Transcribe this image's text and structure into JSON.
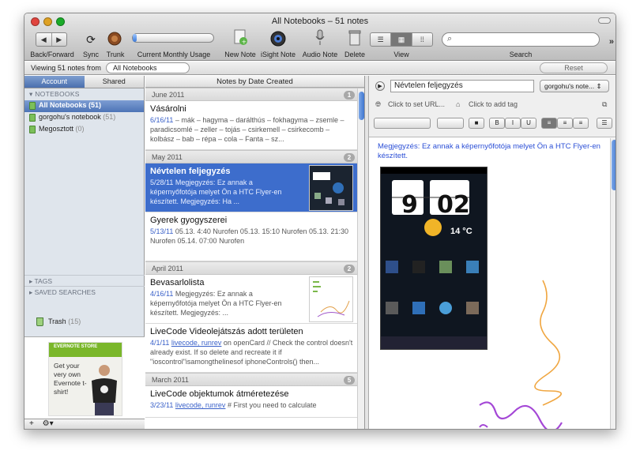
{
  "window": {
    "title": "All Notebooks – 51 notes"
  },
  "toolbar": {
    "back_forward": "Back/Forward",
    "sync": "Sync",
    "trunk": "Trunk",
    "usage": "Current Monthly Usage",
    "usage_fraction": 0.05,
    "new_note": "New Note",
    "isight_note": "iSight Note",
    "audio_note": "Audio Note",
    "delete": "Delete",
    "view": "View",
    "search": "Search"
  },
  "filter": {
    "viewing_label": "Viewing 51 notes from",
    "scope_value": "All Notebooks",
    "reset": "Reset"
  },
  "sidebar": {
    "tabs": [
      "Account",
      "Shared"
    ],
    "notebooks_header": "NOTEBOOKS",
    "notebooks": [
      {
        "name": "All Notebooks",
        "count": "(51)"
      },
      {
        "name": "gorgohu's notebook",
        "count": "(51)"
      },
      {
        "name": "Megosztott",
        "count": "(0)"
      }
    ],
    "tags_header": "TAGS",
    "saved_header": "SAVED SEARCHES",
    "trash": {
      "name": "Trash",
      "count": "(15)"
    },
    "ad": {
      "brand": "EVERNOTE STORE",
      "text": "Get your very own Evernote t-shirt!"
    }
  },
  "notes_list": {
    "header": "Notes by Date Created",
    "groups": [
      {
        "month": "June 2011",
        "count": "1",
        "notes": [
          {
            "title": "Vásárolni",
            "date": "6/16/11",
            "snippet": " – mák – hagyma – darálthús – fokhagyma – zsemle – paradicsomlé – zeller – tojás – csirkemell – csirkecomb – kolbász – bab – répa – cola – Fanta – sz..."
          }
        ]
      },
      {
        "month": "May 2011",
        "count": "2",
        "notes": [
          {
            "title": "Névtelen feljegyzés",
            "date": "5/28/11",
            "snippet": " Megjegyzés: Ez annak a képernyőfotója melyet Ön a HTC Flyer-en készített. Megjegyzés: Ha ..."
          },
          {
            "title": "Gyerek gyogyszerei",
            "date": "5/13/11",
            "snippet": " 05.13. 4:40 Nurofen 05.13. 15:10 Nurofen 05.13. 21:30 Nurofen 05.14. 07:00 Nurofen"
          }
        ]
      },
      {
        "month": "April 2011",
        "count": "2",
        "notes": [
          {
            "title": "Bevasarlolista",
            "date": "4/16/11",
            "snippet": " Megjegyzés: Ez annak a képernyőfotója melyet Ön a HTC Flyer-en készített. Megjegyzés: ..."
          },
          {
            "title": "LiveCode Videolejátszás adott területen",
            "date": "4/1/11",
            "tags": "livecode, runrev",
            "snippet": " on openCard // Check the control doesn't already exist. If so delete and recreate it if \"ioscontrol\"isamongthelinesof iphoneControls() then..."
          }
        ]
      },
      {
        "month": "March 2011",
        "count": "5",
        "notes": [
          {
            "title": "LiveCode objektumok átméretezése",
            "date": "3/23/11",
            "tags": "livecode, runrev",
            "snippet": " # First you need to calculate"
          }
        ]
      }
    ]
  },
  "editor": {
    "title": "Névtelen feljegyzés",
    "notebook": "gorgohu's note...",
    "url_placeholder": "Click to set URL...",
    "tag_placeholder": "Click to add tag",
    "body_text": "Megjegyzés: Ez annak a képernyőfotója melyet Ön a HTC Flyer-en készített.",
    "phone_clock_hour": "9",
    "phone_clock_min": "02",
    "phone_temp": "14 °C"
  },
  "colors": {
    "accent": "#3d6dcc",
    "link": "#2b4fd6",
    "evernote_green": "#7ab72a"
  }
}
